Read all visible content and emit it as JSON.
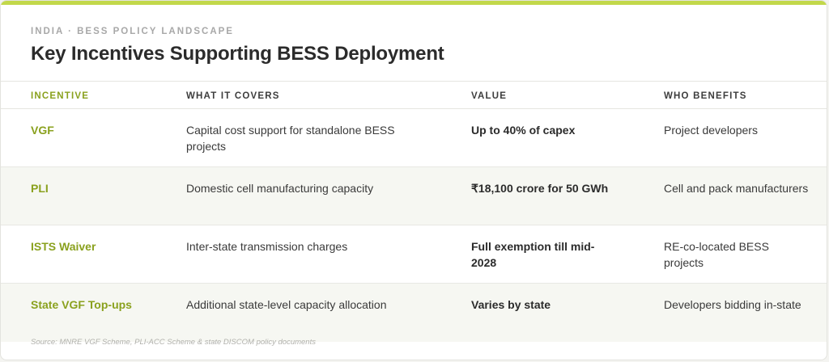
{
  "header": {
    "eyebrow": "INDIA · BESS POLICY LANDSCAPE",
    "title": "Key Incentives Supporting BESS Deployment"
  },
  "table": {
    "columns": [
      "INCENTIVE",
      "WHAT IT COVERS",
      "VALUE",
      "WHO BENEFITS"
    ],
    "rows": [
      {
        "incentive": "VGF",
        "covers": "Capital cost support for standalone BESS projects",
        "value": "Up to 40% of capex",
        "benefits": "Project developers"
      },
      {
        "incentive": "PLI",
        "covers": "Domestic cell manufacturing capacity",
        "value": "₹18,100 crore for 50 GWh",
        "benefits": "Cell and pack manufacturers"
      },
      {
        "incentive": "ISTS Waiver",
        "covers": "Inter-state transmission charges",
        "value": "Full exemption till mid-2028",
        "benefits": "RE-co-located BESS projects"
      },
      {
        "incentive": "State VGF Top-ups",
        "covers": "Additional state-level capacity allocation",
        "value": "Varies by state",
        "benefits": "Developers bidding in-state"
      }
    ]
  },
  "footer": {
    "source": "Source: MNRE VGF Scheme, PLI-ACC Scheme & state DISCOM policy documents"
  },
  "colors": {
    "accent": "#8aa11e",
    "top_bar": "#c2d84a",
    "alt_row": "#f6f7f2"
  }
}
